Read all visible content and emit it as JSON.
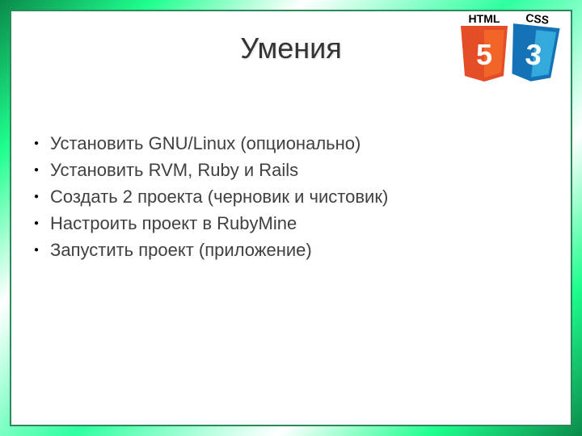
{
  "title": "Умения",
  "logos": {
    "html5_top": "HTML",
    "html5_num": "5",
    "css3_top": "CSS",
    "css3_num": "3"
  },
  "bullets": [
    "Установить GNU/Linux (опционально)",
    "Установить RVM, Ruby и Rails",
    "Создать 2 проекта (черновик и чистовик)",
    "Настроить проект в RubyMine",
    "Запустить проект (приложение)"
  ]
}
